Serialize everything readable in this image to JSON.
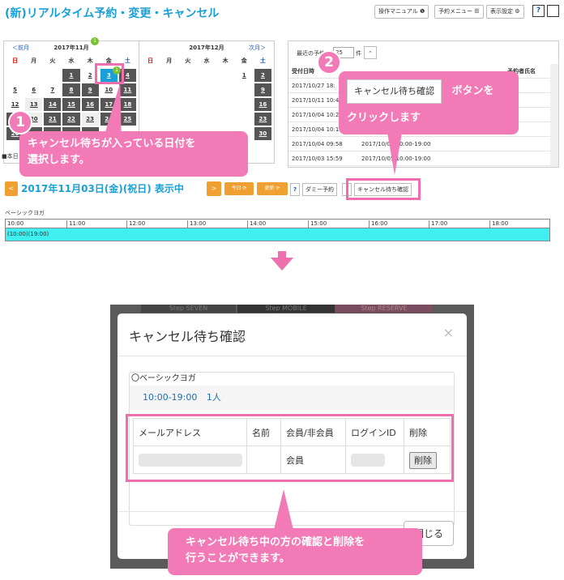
{
  "page": {
    "title": "(新)リアルタイム予約・変更・キャンセル"
  },
  "top_buttons": {
    "manual": "操作マニュアル ❶",
    "menu": "予約メニュー ☰",
    "display": "表示設定 ⚙",
    "help": "?"
  },
  "cal_nov": {
    "prev": "＜前月",
    "title": "2017年11月",
    "badge": "1"
  },
  "cal_dec": {
    "next": "次月＞",
    "title": "2017年12月"
  },
  "weekdays": [
    "日",
    "月",
    "火",
    "水",
    "木",
    "金",
    "土"
  ],
  "legend": "■本日",
  "recent": {
    "label": "最近の予約",
    "select": "25",
    "unit": "件",
    "up": "⌃",
    "col_date": "受付日時",
    "col_name": "予約者氏名",
    "rows": [
      {
        "date": "2017/10/27 18:",
        "slot": ""
      },
      {
        "date": "2017/10/11 10:4",
        "slot": ""
      },
      {
        "date": "2017/10/04 10:2",
        "slot": ""
      },
      {
        "date": "2017/10/04 10:1",
        "slot": ""
      },
      {
        "date": "2017/10/04 09:58",
        "slot": "2017/10/04 10:00-19:00"
      },
      {
        "date": "2017/10/03 15:59",
        "slot": "2017/10/05 10:00-19:00"
      }
    ]
  },
  "callout1": {
    "num": "1",
    "line1": "キャンセル待ちが入っている日付を",
    "line2": "選択します。"
  },
  "callout2": {
    "num": "2",
    "button": "キャンセル待ち確認",
    "suffix": "ボタンを",
    "line2": "クリックします"
  },
  "datebar": {
    "prev": "<",
    "text": "2017年11月03日(金)(祝日) 表示中",
    "next": ">",
    "today": "今日 ⟳",
    "refresh": "更新 ⟳",
    "help": "?",
    "dummy": "ダミー予約",
    "cancel_wait": "キャンセル待ち確認"
  },
  "timeline": {
    "lesson": "ベーシックヨガ",
    "hours": [
      "10:00",
      "11:00",
      "12:00",
      "13:00",
      "14:00",
      "15:00",
      "16:00",
      "17:00",
      "18:00"
    ],
    "bar": "(10:00)(19:00)"
  },
  "modal": {
    "title": "キャンセル待ち確認",
    "close_x": "×",
    "lesson": "〇ベーシックヨガ",
    "time": "10:00-19:00",
    "count": "1人",
    "headers": [
      "メールアドレス",
      "名前",
      "会員/非会員",
      "ログインID",
      "削除"
    ],
    "row_member": "会員",
    "delete": "削除",
    "close": "閉じる"
  },
  "bg_tabs": [
    "Step SEVEN",
    "Step MOBILE",
    "Step RESERVE"
  ],
  "callout3": {
    "line1": "キャンセル待ち中の方の確認と削除を",
    "line2": "行うことができます。"
  }
}
